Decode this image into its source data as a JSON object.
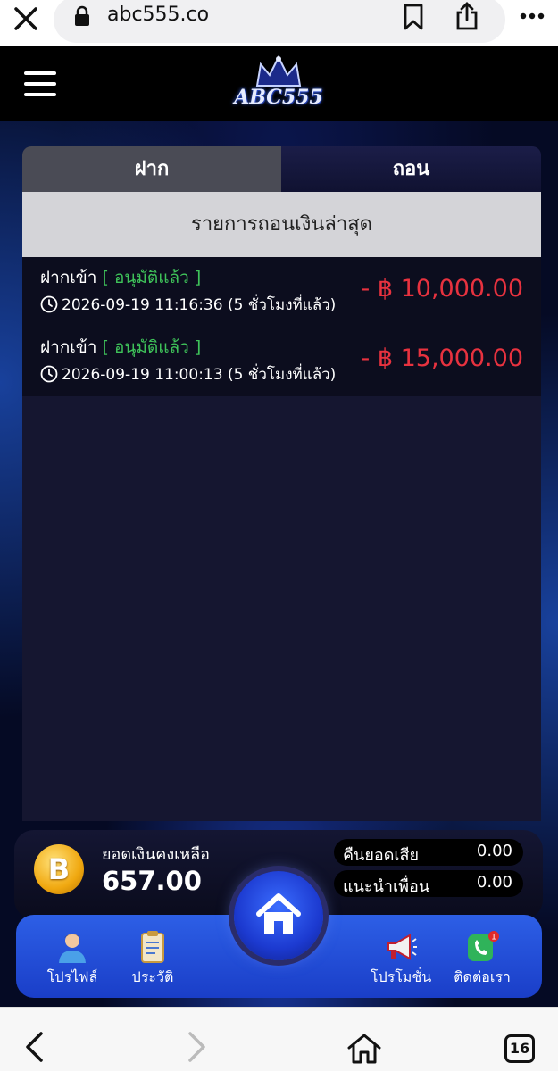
{
  "browser": {
    "url": "abc555.co",
    "tab_count": "16"
  },
  "header": {
    "logo_text": "ABC555"
  },
  "tabs": {
    "deposit": "ฝาก",
    "withdraw": "ถอน"
  },
  "section_title": "รายการถอนเงินล่าสุด",
  "transactions": [
    {
      "type": "ฝากเข้า",
      "status": "[ อนุมัติแล้ว ]",
      "time": "2026-09-19 11:16:36 (5 ชั่วโมงที่แล้ว)",
      "amount": "- ฿ 10,000.00"
    },
    {
      "type": "ฝากเข้า",
      "status": "[ อนุมัติแล้ว ]",
      "time": "2026-09-19 11:00:13 (5 ชั่วโมงที่แล้ว)",
      "amount": "- ฿ 15,000.00"
    }
  ],
  "balance": {
    "coin_symbol": "B",
    "label": "ยอดเงินคงเหลือ",
    "value": "657.00"
  },
  "stats": [
    {
      "label": "คืนยอดเสีย",
      "value": "0.00"
    },
    {
      "label": "แนะนำเพื่อน",
      "value": "0.00"
    }
  ],
  "nav": {
    "profile": "โปรไฟล์",
    "history": "ประวัติ",
    "promotion": "โปรโมชั่น",
    "contact": "ติดต่อเรา",
    "contact_badge": "1"
  },
  "colors": {
    "accent_blue": "#2d5fe6",
    "amount_red": "#e8323f",
    "status_green": "#3fc35a"
  }
}
